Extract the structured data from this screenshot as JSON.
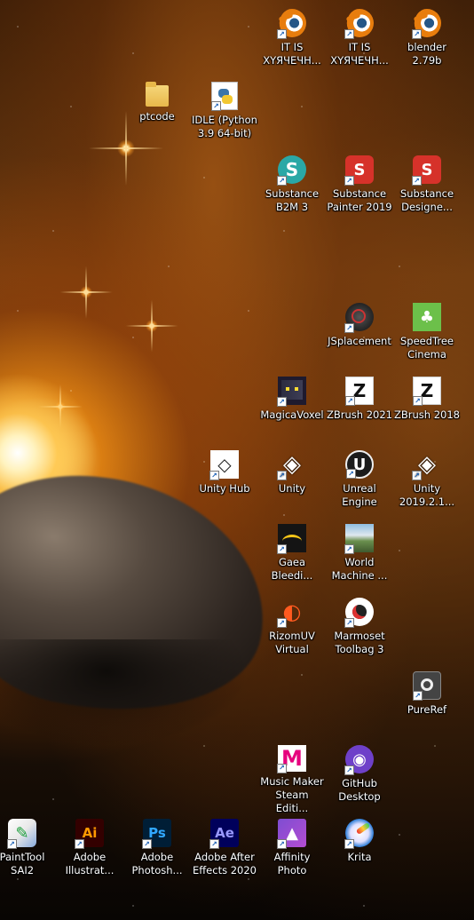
{
  "desktop": {
    "icons": [
      {
        "label": "IT IS\nXYЯЧЕЧН...",
        "icon": "blender-icon"
      },
      {
        "label": "IT IS\nXYЯЧЕЧН...",
        "icon": "blender-icon"
      },
      {
        "label": "blender 2.79b",
        "icon": "blender-icon"
      },
      {
        "label": "ptcode",
        "icon": "folder-icon"
      },
      {
        "label": "IDLE (Python\n3.9 64-bit)",
        "icon": "python-idle-icon"
      },
      {
        "label": "Substance\nB2M 3",
        "icon": "substance-b2m-icon"
      },
      {
        "label": "Substance\nPainter 2019",
        "icon": "substance-painter-icon"
      },
      {
        "label": "Substance\nDesigne...",
        "icon": "substance-designer-icon"
      },
      {
        "label": "JSplacement",
        "icon": "jsplacement-icon"
      },
      {
        "label": "SpeedTree\nCinema",
        "icon": "speedtree-icon"
      },
      {
        "label": "MagicaVoxel",
        "icon": "magicavoxel-icon"
      },
      {
        "label": "ZBrush 2021",
        "icon": "zbrush-icon"
      },
      {
        "label": "ZBrush 2018",
        "icon": "zbrush-icon"
      },
      {
        "label": "Unity Hub",
        "icon": "unity-hub-icon"
      },
      {
        "label": "Unity",
        "icon": "unity-icon"
      },
      {
        "label": "Unreal\nEngine",
        "icon": "unreal-engine-icon"
      },
      {
        "label": "Unity\n2019.2.1...",
        "icon": "unity-icon"
      },
      {
        "label": "Gaea\nBleedi...",
        "icon": "gaea-icon"
      },
      {
        "label": "World\nMachine ...",
        "icon": "world-machine-icon"
      },
      {
        "label": "RizomUV\nVirtual",
        "icon": "rizomuv-icon"
      },
      {
        "label": "Marmoset\nToolbag 3",
        "icon": "marmoset-icon"
      },
      {
        "label": "PureRef",
        "icon": "pureref-icon"
      },
      {
        "label": "Music Maker\nSteam Editi...",
        "icon": "music-maker-icon"
      },
      {
        "label": "GitHub\nDesktop",
        "icon": "github-desktop-icon"
      },
      {
        "label": "PaintTool\nSAI2",
        "icon": "painttool-sai-icon"
      },
      {
        "label": "Adobe\nIllustrat...",
        "icon": "adobe-illustrator-icon"
      },
      {
        "label": "Adobe\nPhotosh...",
        "icon": "adobe-photoshop-icon"
      },
      {
        "label": "Adobe After\nEffects 2020",
        "icon": "adobe-after-effects-icon"
      },
      {
        "label": "Affinity\nPhoto",
        "icon": "affinity-photo-icon"
      },
      {
        "label": "Krita",
        "icon": "krita-icon"
      }
    ]
  }
}
